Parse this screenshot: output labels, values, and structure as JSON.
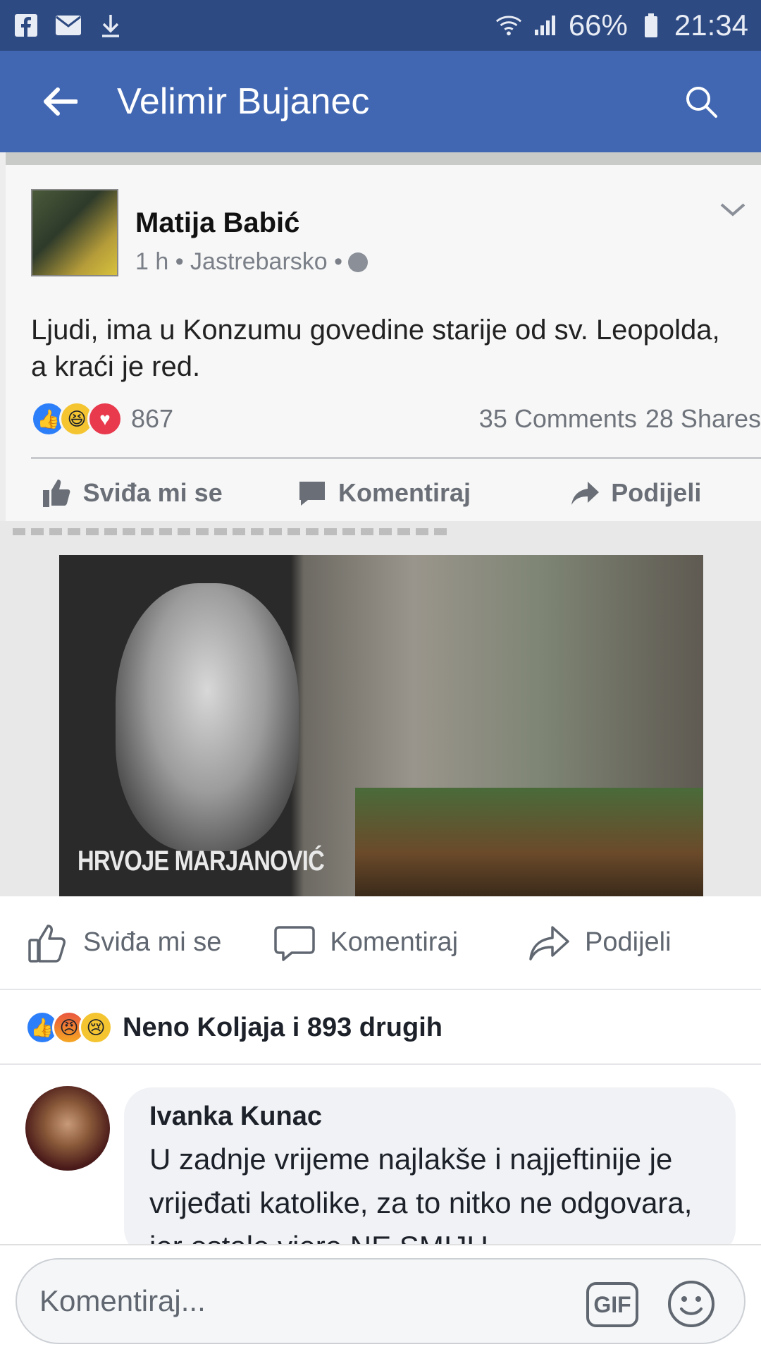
{
  "status_bar": {
    "battery": "66%",
    "time": "21:34",
    "left_icons": [
      "facebook-icon",
      "mail-icon",
      "download-icon"
    ],
    "right_icons": [
      "wifi-icon",
      "signal-icon",
      "battery-icon"
    ]
  },
  "app_bar": {
    "title": "Velimir Bujanec",
    "back_icon": "back-arrow-icon",
    "search_icon": "search-icon"
  },
  "shared_post": {
    "author": "Matija Babić",
    "meta": "1 h • Jastrebarsko •",
    "text": "Ljudi, ima u Konzumu govedine starije od sv. Leopolda, a kraći je red.",
    "reaction_count": "867",
    "comments": "35 Comments",
    "shares": "28 Shares",
    "actions": {
      "like": "Sviđa mi se",
      "comment": "Komentiraj",
      "share": "Podijeli"
    },
    "photo_caption": "HRVOJE MARJANOVIĆ"
  },
  "post_actions": {
    "like": "Sviđa mi se",
    "comment": "Komentiraj",
    "share": "Podijeli"
  },
  "reaction_summary": {
    "text": "Neno Koljaja i 893 drugih",
    "icons": [
      "like-reaction",
      "angry-reaction",
      "sad-reaction"
    ]
  },
  "comments": [
    {
      "author": "Ivanka Kunac",
      "text": "U zadnje vrijeme najlakše i najjeftinije je vrijeđati katolike, za to nitko ne odgovara, jer ostale vjere NE SMIJU"
    }
  ],
  "composer": {
    "placeholder": "Komentiraj...",
    "gif_label": "GIF"
  },
  "colors": {
    "status_bar": "#2d4a82",
    "app_bar": "#4267b2",
    "like_blue": "#2d7ff9",
    "text_primary": "#1d2129",
    "text_secondary": "#606770"
  }
}
